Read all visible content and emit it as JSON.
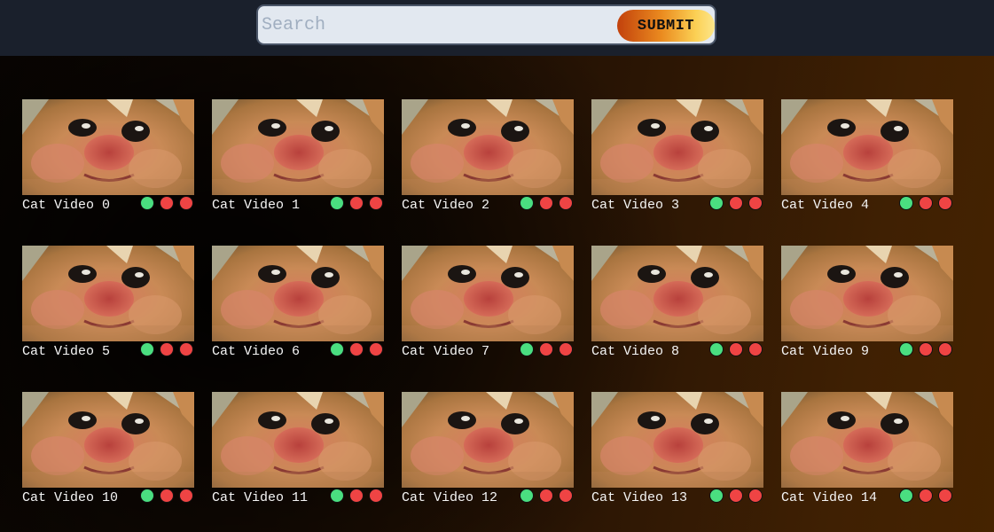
{
  "search": {
    "placeholder": "Search",
    "value": "",
    "submit_label": "SUBMIT"
  },
  "colors": {
    "topbar": "#1a202c",
    "accent_start": "#c2410c",
    "accent_end": "#fde68a",
    "status_green": "#4ade80",
    "status_red": "#ef4444"
  },
  "videos": [
    {
      "title": "Cat Video 0"
    },
    {
      "title": "Cat Video 1"
    },
    {
      "title": "Cat Video 2"
    },
    {
      "title": "Cat Video 3"
    },
    {
      "title": "Cat Video 4"
    },
    {
      "title": "Cat Video 5"
    },
    {
      "title": "Cat Video 6"
    },
    {
      "title": "Cat Video 7"
    },
    {
      "title": "Cat Video 8"
    },
    {
      "title": "Cat Video 9"
    },
    {
      "title": "Cat Video 10"
    },
    {
      "title": "Cat Video 11"
    },
    {
      "title": "Cat Video 12"
    },
    {
      "title": "Cat Video 13"
    },
    {
      "title": "Cat Video 14"
    }
  ],
  "status_dots": [
    "green",
    "red",
    "red"
  ],
  "thumbnail_icon": "cat-face-thumbnail"
}
